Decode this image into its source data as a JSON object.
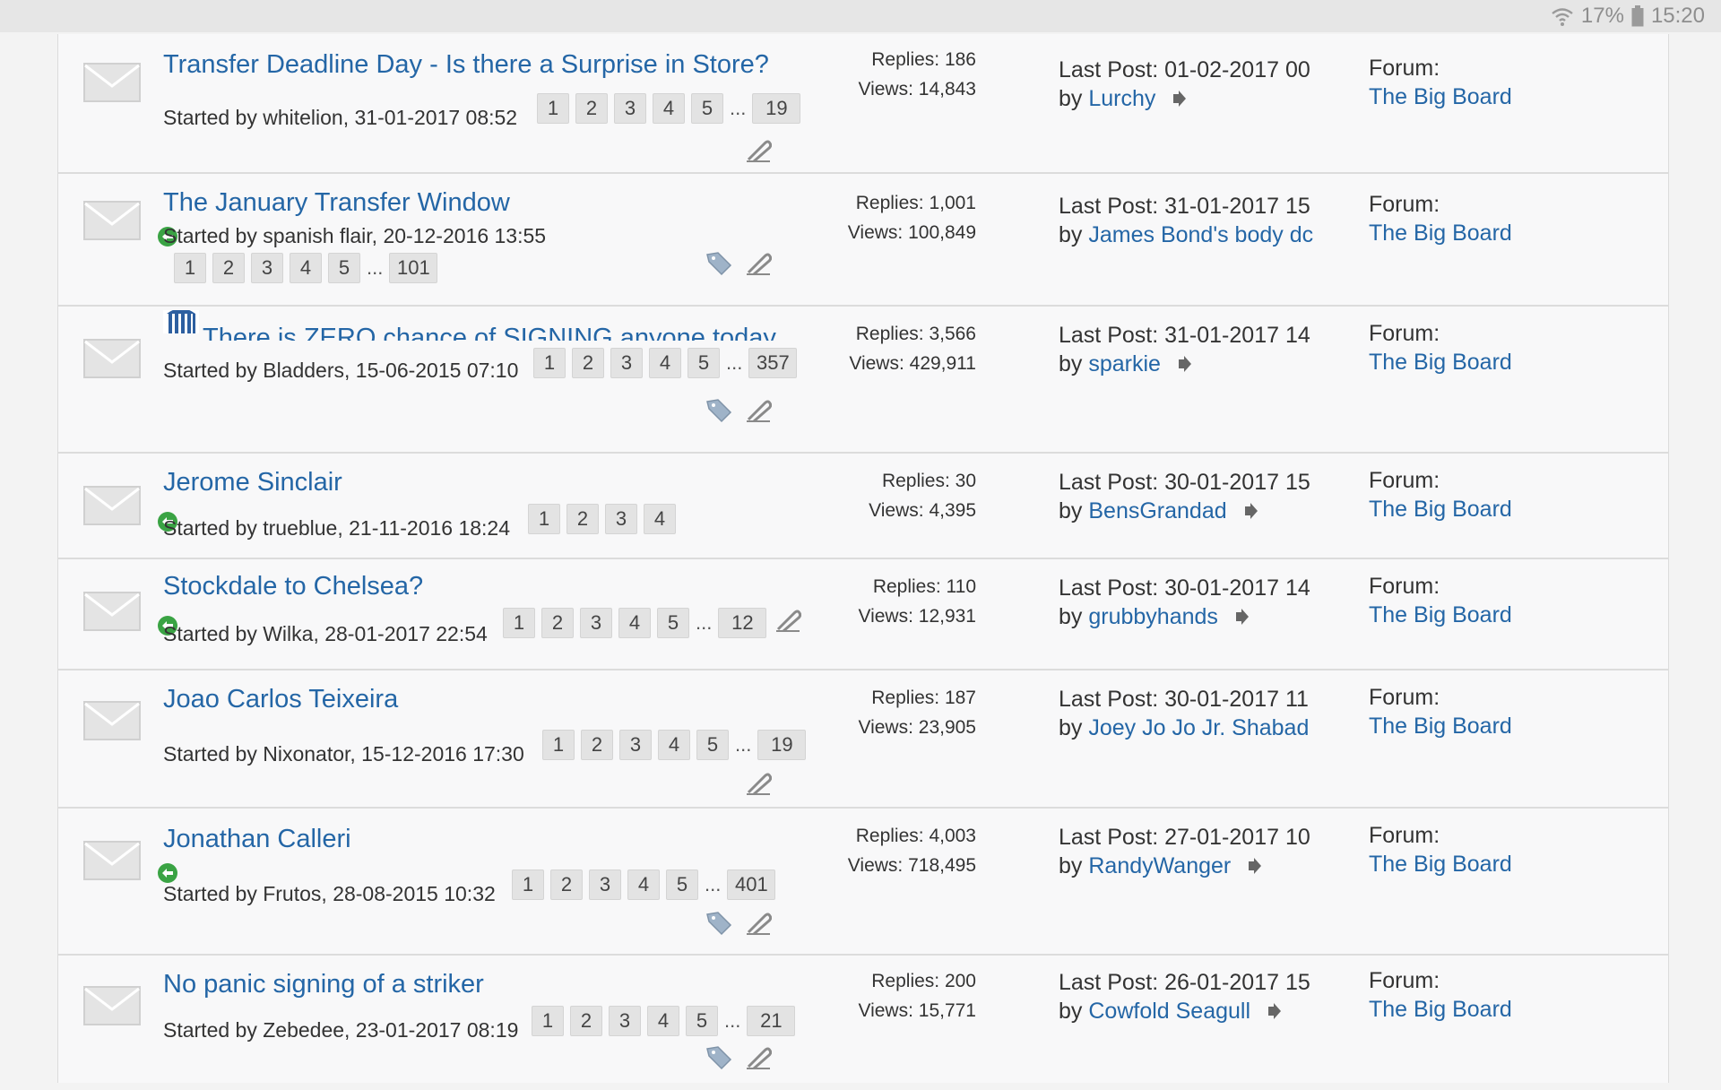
{
  "status_bar": {
    "battery": "17%",
    "time": "15:20",
    "icons": [
      "wifi-icon",
      "battery-icon"
    ]
  },
  "threads": [
    {
      "title": "Transfer Deadline Day - Is there a Surprise in Store?",
      "started_by": "Started by whitelion, 31-01-2017 08:52",
      "pages": [
        "1",
        "2",
        "3",
        "4",
        "5",
        "...",
        "19"
      ],
      "replies": "Replies: 186",
      "views": "Views: 14,843",
      "last_post": "Last Post: 01-02-2017 00",
      "by_prefix": "by",
      "last_poster": "Lurchy",
      "forum_label": "Forum:",
      "forum_name": "The Big Board"
    },
    {
      "title": "The January Transfer Window",
      "started_by": "Started by spanish flair, 20-12-2016 13:55",
      "pages": [
        "1",
        "2",
        "3",
        "4",
        "5",
        "...",
        "101"
      ],
      "replies": "Replies: 1,001",
      "views": "Views: 100,849",
      "last_post": "Last Post: 31-01-2017 15",
      "by_prefix": "by",
      "last_poster": "James Bond's body dc",
      "forum_label": "Forum:",
      "forum_name": "The Big Board"
    },
    {
      "title": "There is ZERO chance of SIGNING anyone today",
      "started_by": "Started by Bladders, 15-06-2015 07:10",
      "pages": [
        "1",
        "2",
        "3",
        "4",
        "5",
        "...",
        "357"
      ],
      "replies": "Replies: 3,566",
      "views": "Views: 429,911",
      "last_post": "Last Post: 31-01-2017 14",
      "by_prefix": "by",
      "last_poster": "sparkie",
      "forum_label": "Forum:",
      "forum_name": "The Big Board"
    },
    {
      "title": "Jerome Sinclair",
      "started_by": "Started by trueblue, 21-11-2016 18:24",
      "pages": [
        "1",
        "2",
        "3",
        "4"
      ],
      "replies": "Replies: 30",
      "views": "Views: 4,395",
      "last_post": "Last Post: 30-01-2017 15",
      "by_prefix": "by",
      "last_poster": "BensGrandad",
      "forum_label": "Forum:",
      "forum_name": "The Big Board"
    },
    {
      "title": "Stockdale to Chelsea?",
      "started_by": "Started by Wilka, 28-01-2017 22:54",
      "pages": [
        "1",
        "2",
        "3",
        "4",
        "5",
        "...",
        "12"
      ],
      "replies": "Replies: 110",
      "views": "Views: 12,931",
      "last_post": "Last Post: 30-01-2017 14",
      "by_prefix": "by",
      "last_poster": "grubbyhands",
      "forum_label": "Forum:",
      "forum_name": "The Big Board"
    },
    {
      "title": "Joao Carlos Teixeira",
      "started_by": "Started by Nixonator, 15-12-2016 17:30",
      "pages": [
        "1",
        "2",
        "3",
        "4",
        "5",
        "...",
        "19"
      ],
      "replies": "Replies: 187",
      "views": "Views: 23,905",
      "last_post": "Last Post: 30-01-2017 11",
      "by_prefix": "by",
      "last_poster": "Joey Jo Jo Jr. Shabad",
      "forum_label": "Forum:",
      "forum_name": "The Big Board"
    },
    {
      "title": "Jonathan Calleri",
      "started_by": "Started by Frutos, 28-08-2015 10:32",
      "pages": [
        "1",
        "2",
        "3",
        "4",
        "5",
        "...",
        "401"
      ],
      "replies": "Replies: 4,003",
      "views": "Views: 718,495",
      "last_post": "Last Post: 27-01-2017 10",
      "by_prefix": "by",
      "last_poster": "RandyWanger",
      "forum_label": "Forum:",
      "forum_name": "The Big Board"
    },
    {
      "title": "No panic signing of a striker",
      "started_by": "Started by Zebedee, 23-01-2017 08:19",
      "pages": [
        "1",
        "2",
        "3",
        "4",
        "5",
        "...",
        "21"
      ],
      "replies": "Replies: 200",
      "views": "Views: 15,771",
      "last_post": "Last Post: 26-01-2017 15",
      "by_prefix": "by",
      "last_poster": "Cowfold Seagull",
      "forum_label": "Forum:",
      "forum_name": "The Big Board"
    }
  ],
  "colors": {
    "link": "#2466a6",
    "badge_green": "#3aa344",
    "envelope": "#d0d0d0"
  }
}
